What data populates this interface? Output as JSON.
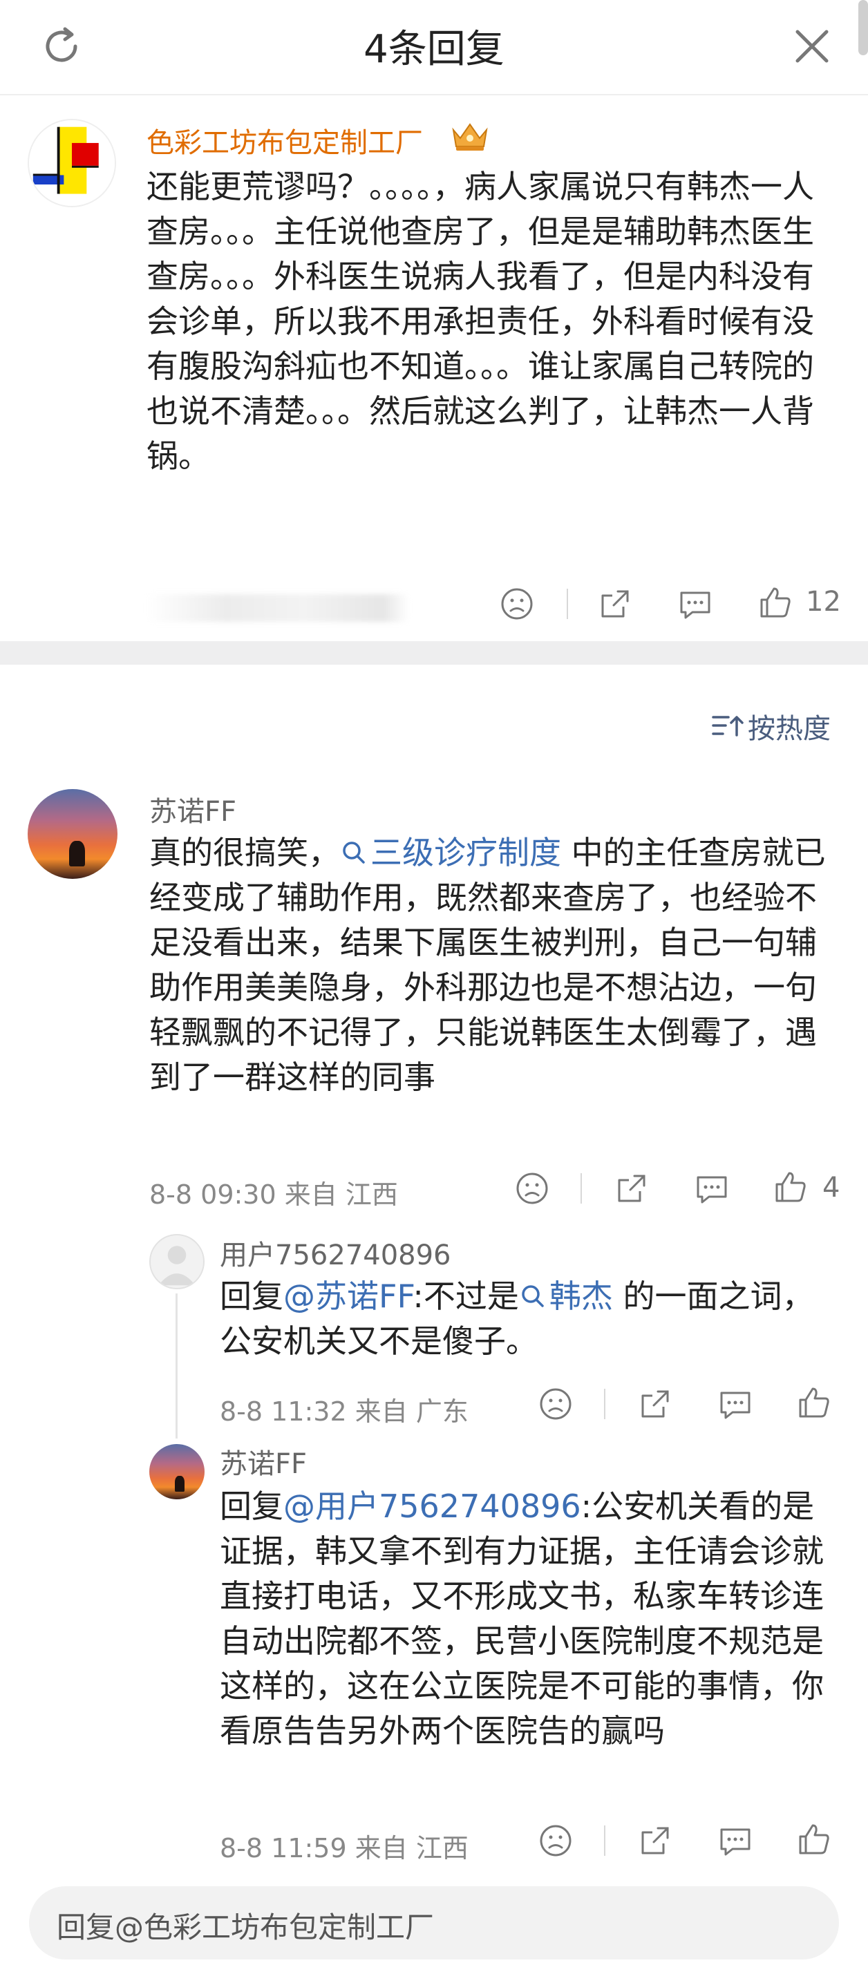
{
  "header": {
    "title": "4条回复"
  },
  "top_comment": {
    "author": "色彩工坊布包定制工厂",
    "text": "还能更荒谬吗？。。。。，病人家属说只有韩杰一人查房。。。主任说他查房了，但是是辅助韩杰医生查房。。。外科医生说病人我看了，但是内科没有会诊单，所以我不用承担责任，外科看时候有没有腹股沟斜疝也不知道。。。谁让家属自己转院的也说不清楚。。。然后就这么判了，让韩杰一人背锅。",
    "like_count": "12"
  },
  "sort": {
    "label": "按热度"
  },
  "comment": {
    "author": "苏诺FF",
    "text_before": "真的很搞笑，",
    "topic": "三级诊疗制度",
    "text_after": " 中的主任查房就已经变成了辅助作用，既然都来查房了，也经验不足没看出来，结果下属医生被判刑，自己一句辅助作用美美隐身，外科那边也是不想沾边，一句轻飘飘的不记得了，只能说韩医生太倒霉了，遇到了一群这样的同事",
    "meta": "8-8 09:30  来自 江西",
    "like_count": "4"
  },
  "replies": [
    {
      "author": "用户7562740896",
      "prefix": "回复",
      "mention": "@苏诺FF",
      "text_mid": ":不过是",
      "topic": "韩杰",
      "text_after": " 的一面之词，公安机关又不是傻子。",
      "meta": "8-8 11:32  来自 广东"
    },
    {
      "author": "苏诺FF",
      "prefix": "回复",
      "mention": "@用户7562740896",
      "text_after": ":公安机关看的是证据，韩又拿不到有力证据，主任请会诊就直接打电话，又不形成文书，私家车转诊连自动出院都不签，民营小医院制度不规范是这样的，这在公立医院是不可能的事情，你看原告告另外两个医院告的赢吗",
      "meta": "8-8 11:59  来自 江西"
    }
  ],
  "reply_input": {
    "placeholder": "回复@色彩工坊布包定制工厂"
  },
  "icons": {
    "refresh": "refresh-icon",
    "close": "close-icon",
    "dislike": "dislike-face-icon",
    "share": "share-icon",
    "comment": "comment-icon",
    "like": "thumbs-up-icon",
    "sort": "sort-icon",
    "crown": "vip-crown-icon",
    "search_topic": "search-topic-icon"
  },
  "colors": {
    "author_vip": "#e06c00",
    "link": "#3c6eb4",
    "secondary_text": "#888888"
  }
}
